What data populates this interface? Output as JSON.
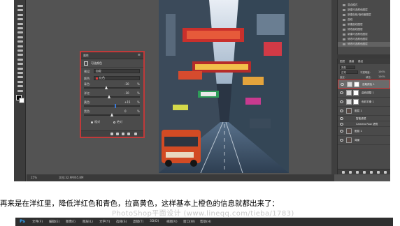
{
  "colors": {
    "selection_outline": "#d33d3d",
    "photoshop_bg": "#535353",
    "ps_logo": "#31a8ff"
  },
  "toolbar": {
    "tools": [
      "move-tool",
      "marquee-tool",
      "lasso-tool",
      "quick-select-tool",
      "crop-tool",
      "eyedropper-tool",
      "healing-tool",
      "brush-tool",
      "clone-tool",
      "history-brush-tool",
      "eraser-tool",
      "gradient-tool",
      "blur-tool",
      "dodge-tool",
      "pen-tool",
      "type-tool",
      "path-select-tool",
      "shape-tool",
      "hand-tool",
      "zoom-tool"
    ]
  },
  "status": {
    "zoom": "25%",
    "doc": "文档:32.9M/65.8M"
  },
  "properties": {
    "tab": "属性",
    "subtitle": "可选颜色",
    "preset_label": "预设:",
    "preset_value": "自定",
    "colors_label": "颜色:",
    "colors_value": "红色",
    "sliders": [
      {
        "label": "青色:",
        "value": "-20",
        "fill": 0.4
      },
      {
        "label": "洋红:",
        "value": "-10",
        "fill": 0.45
      },
      {
        "label": "黄色:",
        "value": "+15",
        "fill": 0.58
      },
      {
        "label": "黑色:",
        "value": "0",
        "fill": 0.5
      }
    ],
    "percent": "%",
    "radio_relative": "相对",
    "radio_absolute": "绝对"
  },
  "history": {
    "items": [
      "混合模式",
      "新建可选颜色图层",
      "新建色相/饱和度图层",
      "曲线",
      "新建曲线图层",
      "修改曲线图层",
      "新建可选颜色图层",
      "修改可选颜色图层",
      "修改可选颜色图层"
    ]
  },
  "layers": {
    "tabs": [
      "图层",
      "通道",
      "路径"
    ],
    "kind": "类型",
    "blend": "正常",
    "opacity_label": "不透明度:",
    "opacity": "100%",
    "lock_label": "锁定:",
    "fill_label": "填充:",
    "fill": "100%",
    "rows": [
      {
        "name": "选取颜色 1",
        "kind": "adj",
        "selected": true
      },
      {
        "name": "曲线调整 1",
        "kind": "adj",
        "selected": false
      },
      {
        "name": "色彩平衡 1",
        "kind": "adj",
        "selected": false
      },
      {
        "name": "图层 1",
        "kind": "photo",
        "selected": false
      },
      {
        "name": "智能滤镜",
        "kind": "effect",
        "selected": false
      },
      {
        "name": "Camera Raw 滤镜",
        "kind": "effect",
        "selected": false
      },
      {
        "name": "图层 1",
        "kind": "photo",
        "selected": false
      },
      {
        "name": "背景",
        "kind": "photo",
        "selected": false
      }
    ]
  },
  "caption": "再来是在洋红里，降低洋红色和青色，拉高黄色，这样基本上橙色的信息就都出来了：",
  "watermark": "PhotoShop平面设计 (www.lineqq.com/tieba/1783)",
  "window2": {
    "logo": "Ps",
    "menus": [
      "文件(F)",
      "编辑(E)",
      "图像(I)",
      "图层(L)",
      "文字(Y)",
      "选择(S)",
      "滤镜(T)",
      "3D(D)",
      "视图(V)",
      "窗口(W)",
      "帮助(H)"
    ]
  }
}
